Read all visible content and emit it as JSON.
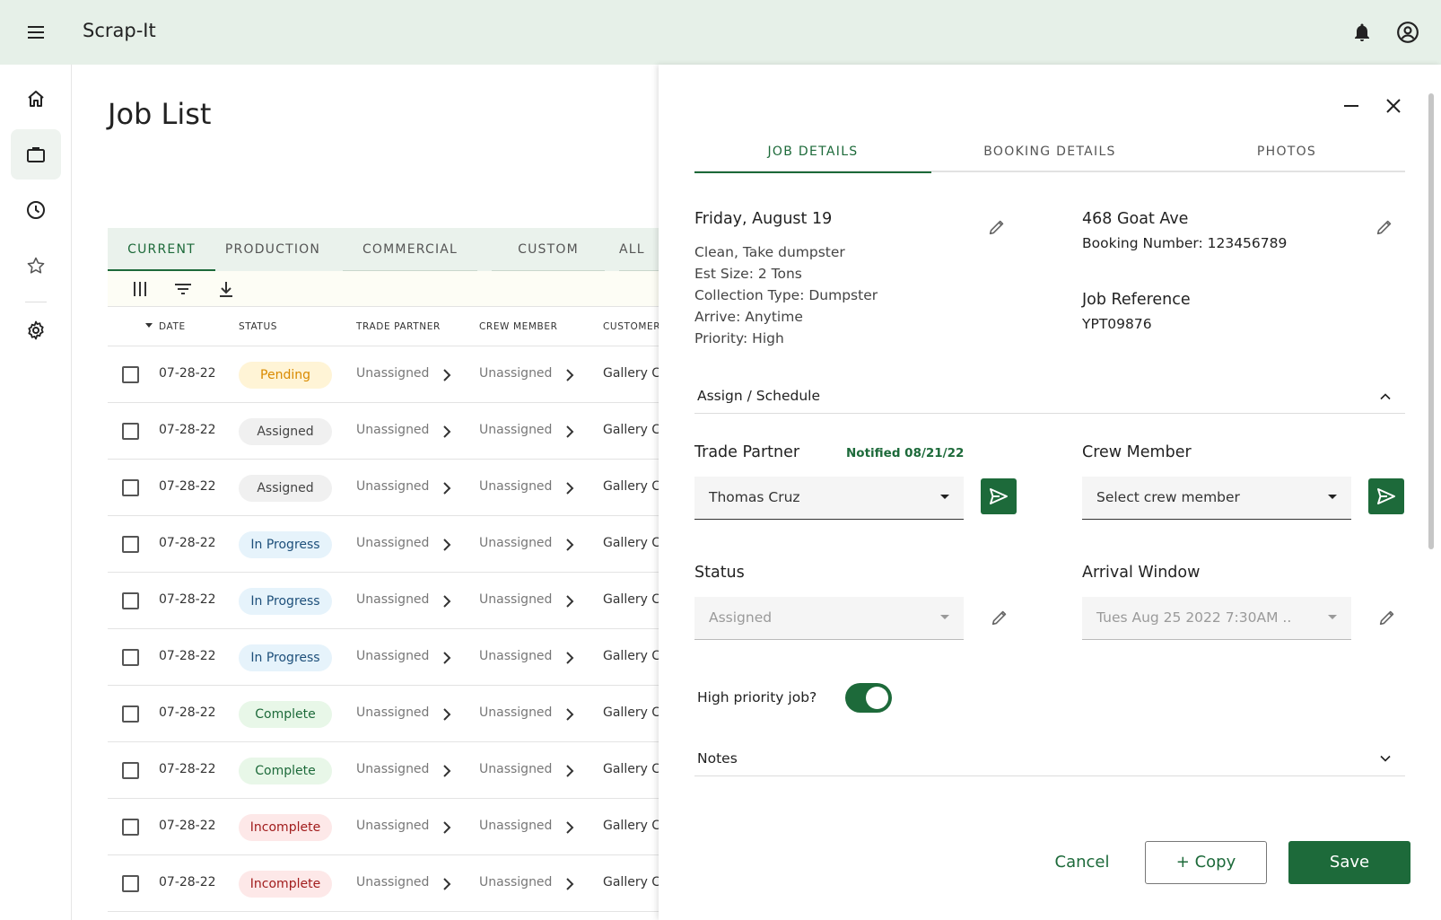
{
  "app": {
    "title": "Scrap-It"
  },
  "icons": {
    "menu": "menu-icon",
    "bell": "bell-icon",
    "account": "account-icon",
    "home": "home-icon",
    "jobs": "briefcase-icon",
    "history": "clock-icon",
    "favorites": "star-icon",
    "settings": "gear-icon"
  },
  "colors": {
    "primary": "#1d6a3a",
    "topbar": "#e6f0e8"
  },
  "list": {
    "title": "Job List",
    "tabs": [
      "CURRENT",
      "PRODUCTION",
      "COMMERCIAL",
      "CUSTOM",
      "ALL"
    ],
    "columns": [
      "DATE",
      "STATUS",
      "TRADE PARTNER",
      "CREW MEMBER",
      "CUSTOMER"
    ],
    "rows": [
      {
        "date": "07-28-22",
        "status": "Pending",
        "trade_partner": "Unassigned",
        "crew_member": "Unassigned",
        "customer": "Gallery Cu"
      },
      {
        "date": "07-28-22",
        "status": "Assigned",
        "trade_partner": "Unassigned",
        "crew_member": "Unassigned",
        "customer": "Gallery Cu"
      },
      {
        "date": "07-28-22",
        "status": "Assigned",
        "trade_partner": "Unassigned",
        "crew_member": "Unassigned",
        "customer": "Gallery Cu"
      },
      {
        "date": "07-28-22",
        "status": "In Progress",
        "trade_partner": "Unassigned",
        "crew_member": "Unassigned",
        "customer": "Gallery Cu"
      },
      {
        "date": "07-28-22",
        "status": "In Progress",
        "trade_partner": "Unassigned",
        "crew_member": "Unassigned",
        "customer": "Gallery Cu"
      },
      {
        "date": "07-28-22",
        "status": "In Progress",
        "trade_partner": "Unassigned",
        "crew_member": "Unassigned",
        "customer": "Gallery Cu"
      },
      {
        "date": "07-28-22",
        "status": "Complete",
        "trade_partner": "Unassigned",
        "crew_member": "Unassigned",
        "customer": "Gallery Cu"
      },
      {
        "date": "07-28-22",
        "status": "Complete",
        "trade_partner": "Unassigned",
        "crew_member": "Unassigned",
        "customer": "Gallery Cu"
      },
      {
        "date": "07-28-22",
        "status": "Incomplete",
        "trade_partner": "Unassigned",
        "crew_member": "Unassigned",
        "customer": "Gallery Cu"
      },
      {
        "date": "07-28-22",
        "status": "Incomplete",
        "trade_partner": "Unassigned",
        "crew_member": "Unassigned",
        "customer": "Gallery Cu"
      }
    ],
    "status_colors": {
      "Pending": {
        "bg": "#fff4d6",
        "fg": "#d98a00"
      },
      "Assigned": {
        "bg": "#f0f0f0",
        "fg": "#444444"
      },
      "In Progress": {
        "bg": "#e6f3fb",
        "fg": "#1d4f7a"
      },
      "Complete": {
        "bg": "#e8f7e8",
        "fg": "#1d6a3a"
      },
      "Incomplete": {
        "bg": "#fde8e8",
        "fg": "#a11c1c"
      }
    }
  },
  "panel": {
    "tabs": [
      "JOB DETAILS",
      "BOOKING DETAILS",
      "PHOTOS"
    ],
    "job": {
      "date": "Friday, August 19",
      "lines": [
        "Clean, Take dumpster",
        "Est Size: 2 Tons",
        "Collection Type: Dumpster",
        "Arrive: Anytime",
        "Priority: High"
      ]
    },
    "address": "468 Goat Ave",
    "booking_number": "Booking Number: 123456789",
    "job_reference_label": "Job Reference",
    "job_reference": "YPT09876",
    "assign_section": "Assign / Schedule",
    "trade_partner_label": "Trade Partner",
    "notified": "Notified 08/21/22",
    "trade_partner_value": "Thomas Cruz",
    "crew_member_label": "Crew Member",
    "crew_member_placeholder": "Select crew member",
    "status_label": "Status",
    "status_value": "Assigned",
    "arrival_label": "Arrival Window",
    "arrival_value": "Tues Aug 25 2022 7:30AM ..",
    "high_priority_label": "High priority job?",
    "high_priority": true,
    "notes_label": "Notes",
    "buttons": {
      "cancel": "Cancel",
      "copy": "Copy",
      "save": "Save"
    }
  }
}
